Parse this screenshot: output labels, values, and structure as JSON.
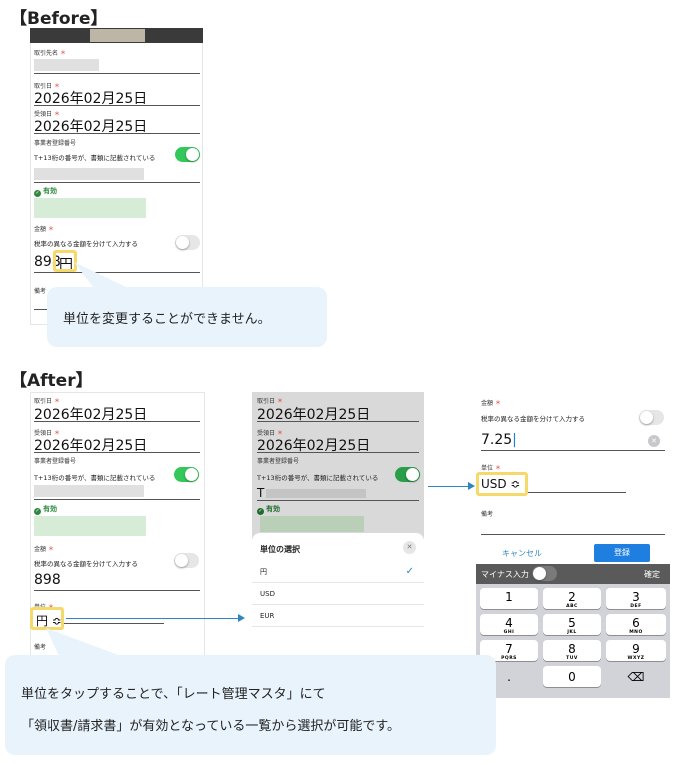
{
  "before": {
    "title": "【Before】",
    "client_label": "取引先名",
    "tx_date_label": "取引日",
    "tx_date": "2026年02月25日",
    "recv_date_label": "受領日",
    "recv_date": "2026年02月25日",
    "reg_label": "事業者登録番号",
    "reg_toggle_text": "T+13桁の番号が、書類に記載されている",
    "valid_text": "有効",
    "amount_label": "金額",
    "tax_split_text": "税率の異なる金額を分けて入力する",
    "amount_value": "898",
    "unit_value": "円",
    "memo_label": "備考",
    "required_mark": "＊",
    "callout": "単位を変更することができません。"
  },
  "after": {
    "title": "【After】",
    "screen1": {
      "tx_date_label": "取引日",
      "tx_date": "2026年02月25日",
      "recv_date_label": "受領日",
      "recv_date": "2026年02月25日",
      "reg_label": "事業者登録番号",
      "reg_toggle_text": "T+13桁の番号が、書類に記載されている",
      "valid_text": "有効",
      "amount_label": "金額",
      "tax_split_text": "税率の異なる金額を分けて入力する",
      "amount_value": "898",
      "unit_label": "単位",
      "unit_value": "円 ≎",
      "memo_label": "備考",
      "required_mark": "＊"
    },
    "screen2": {
      "tx_date_label": "取引日",
      "tx_date": "2026年02月25日",
      "recv_date_label": "受領日",
      "recv_date": "2026年02月25日",
      "reg_label": "事業者登録番号",
      "reg_toggle_text": "T+13桁の番号が、書類に記載されている",
      "reg_value_prefix": "T",
      "valid_text": "有効",
      "sheet_title": "単位の選択",
      "options": [
        "円",
        "USD",
        "EUR"
      ],
      "check": "✓",
      "close": "✕",
      "required_mark": "＊"
    },
    "screen3": {
      "amount_label": "金額",
      "tax_split_text": "税率の異なる金額を分けて入力する",
      "amount_value": "7.25",
      "clear": "✕",
      "unit_label": "単位",
      "unit_value": "USD ≎",
      "memo_label": "備考",
      "cancel": "キャンセル",
      "register": "登録",
      "minus_input": "マイナス入力",
      "confirm": "確定",
      "required_mark": "＊",
      "keys": [
        {
          "n": "1",
          "l": ""
        },
        {
          "n": "2",
          "l": "ABC"
        },
        {
          "n": "3",
          "l": "DEF"
        },
        {
          "n": "4",
          "l": "GHI"
        },
        {
          "n": "5",
          "l": "JKL"
        },
        {
          "n": "6",
          "l": "MNO"
        },
        {
          "n": "7",
          "l": "PQRS"
        },
        {
          "n": "8",
          "l": "TUV"
        },
        {
          "n": "9",
          "l": "WXYZ"
        }
      ],
      "dot_key": ".",
      "zero_key": "0",
      "backspace": "⌫"
    },
    "callout_line1": "単位をタップすることで、「レート管理マスタ」にて",
    "callout_line2": "「領収書/請求書」が有効となっている一覧から選択が可能です。"
  },
  "colors": {
    "accent": "#2e86c1",
    "highlight": "#f5d96b",
    "toggle_on": "#34c759",
    "callout_bg": "#e8f3fc",
    "primary_button": "#1e7fe0"
  }
}
